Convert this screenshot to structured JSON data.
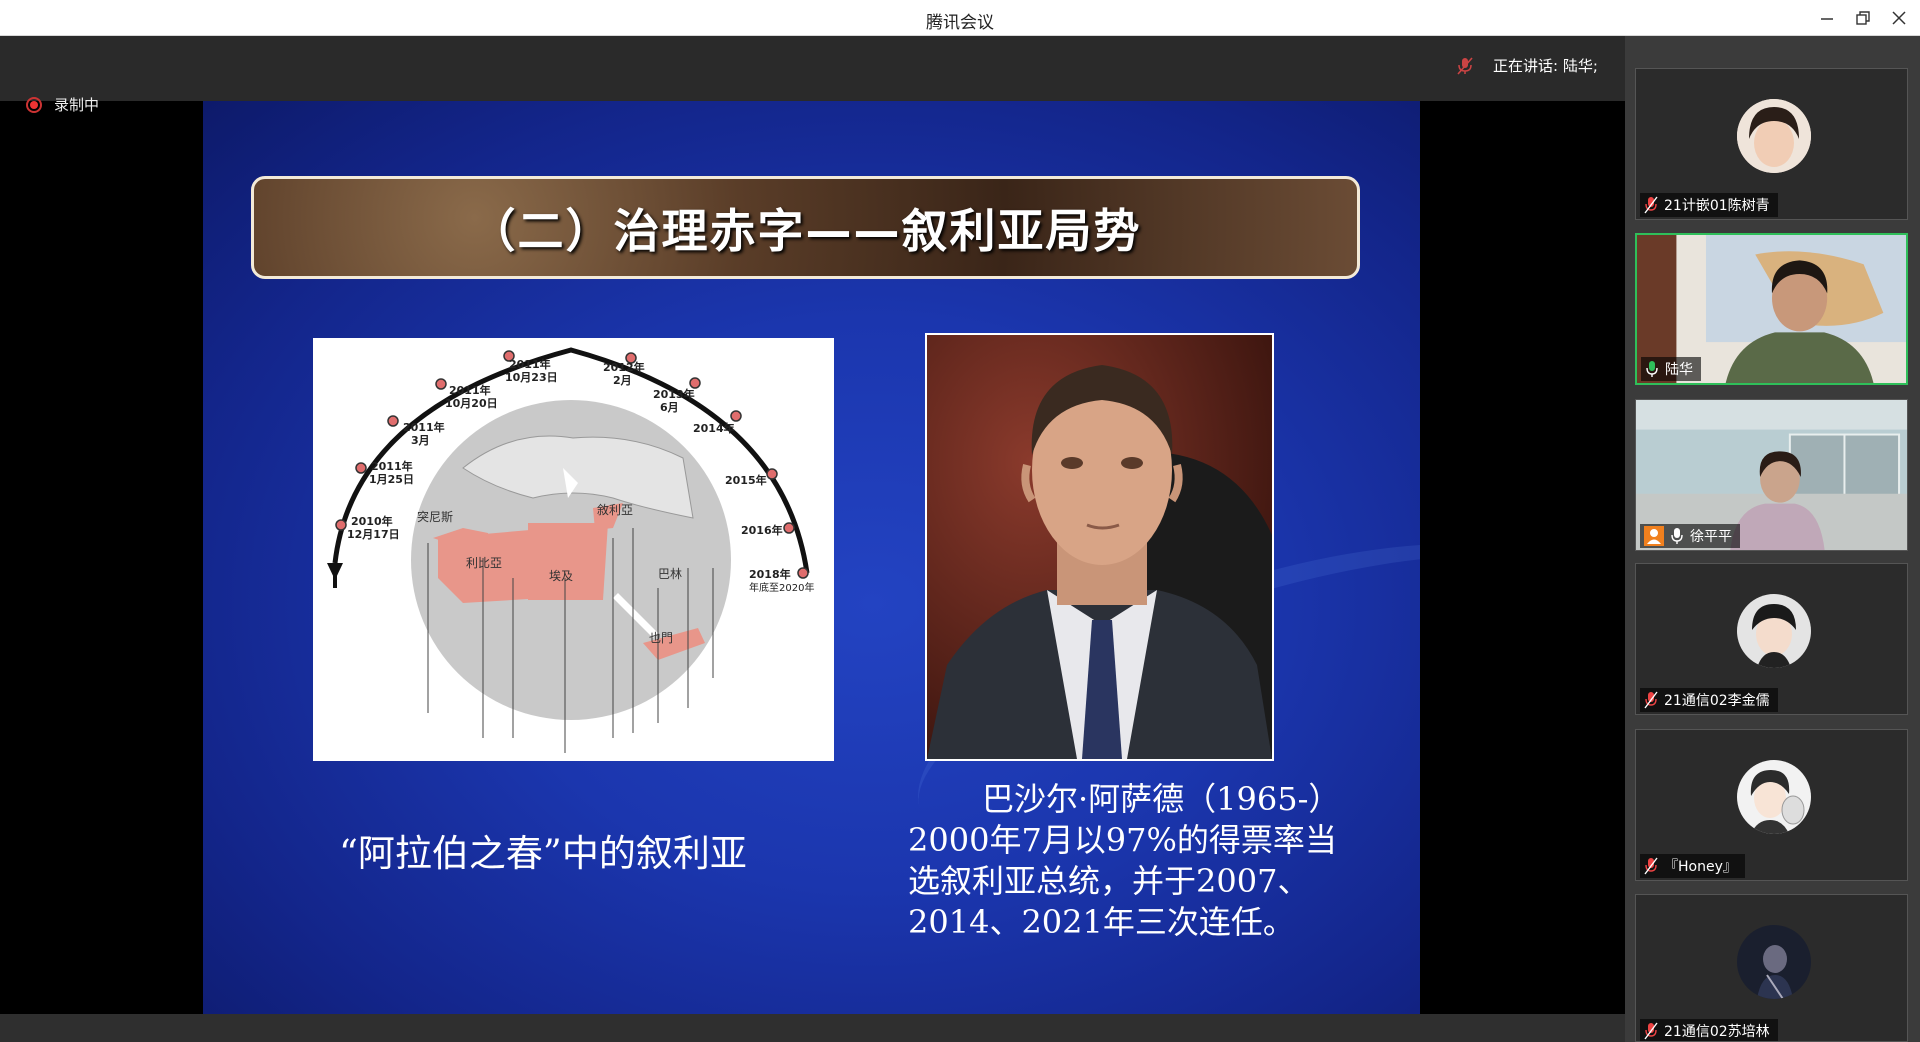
{
  "window": {
    "title": "腾讯会议"
  },
  "recording": {
    "label": "录制中"
  },
  "speaking": {
    "text": "正在讲话: 陆华;"
  },
  "slide": {
    "title": "（二）治理赤字——叙利亚局势",
    "left_caption": "“阿拉伯之春”中的叙利亚",
    "right_caption_lines": [
      "巴沙尔·阿萨德（1965-）",
      "2000年7月以97%的得票率当",
      "选叙利亚总统，并于2007、",
      "2014、2021年三次连任。"
    ],
    "map": {
      "timeline": [
        {
          "year": "2010年",
          "date": "12月17日"
        },
        {
          "year": "2011年",
          "date": "1月25日"
        },
        {
          "year": "2011年",
          "date": "3月"
        },
        {
          "year": "2011年",
          "date": "10月20日"
        },
        {
          "year": "2011年",
          "date": "10月23日"
        },
        {
          "year": "2012年",
          "date": "2月"
        },
        {
          "year": "2013年",
          "date": "6月"
        },
        {
          "year": "2014年",
          "date": ""
        },
        {
          "year": "2015年",
          "date": ""
        },
        {
          "year": "2016年",
          "date": ""
        },
        {
          "year": "2018年",
          "date": "年底至2020年"
        }
      ],
      "countries": [
        "突尼斯",
        "利比亞",
        "埃及",
        "敘利亞",
        "巴林",
        "也門"
      ]
    }
  },
  "participants": [
    {
      "name": "21计嵌01陈树青",
      "mic": "muted",
      "active": false
    },
    {
      "name": "陆华",
      "mic": "on",
      "active": true
    },
    {
      "name": "徐平平",
      "mic": "on",
      "active": false
    },
    {
      "name": "21通信02李金儒",
      "mic": "muted",
      "active": false
    },
    {
      "name": "『Honey』",
      "mic": "muted",
      "active": false
    },
    {
      "name": "21通信02苏培林",
      "mic": "muted",
      "active": false
    }
  ],
  "colors": {
    "accent_green": "#2fbf5a",
    "slide_blue": "#1b36ae",
    "record_red": "#e33"
  }
}
